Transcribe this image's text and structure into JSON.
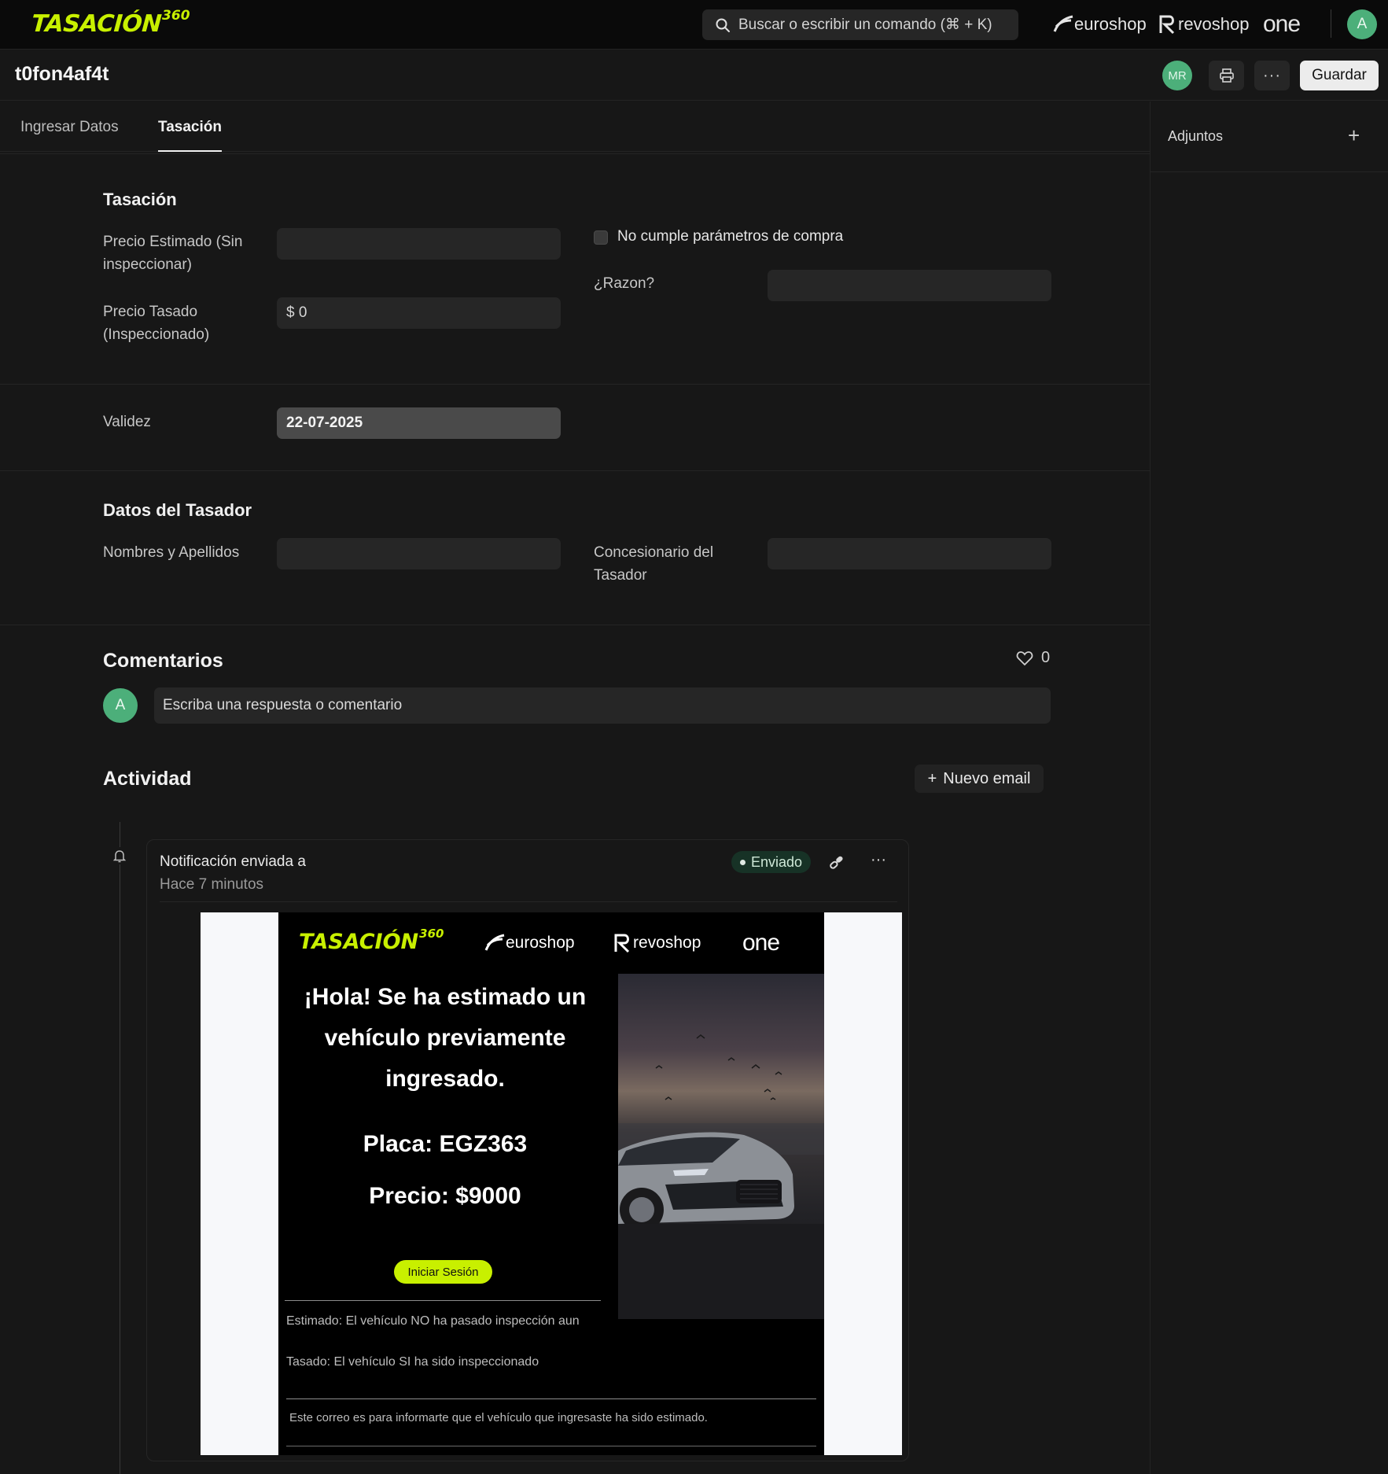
{
  "navbar": {
    "brand": "TASACIÓN",
    "brand_sup": "360",
    "search_placeholder": "Buscar o escribir un comando (⌘ + K)",
    "partners": [
      "euroshop",
      "revoshop",
      "one"
    ],
    "user_initial": "A"
  },
  "header": {
    "doc_title": "t0fon4af4t",
    "assignee_initials": "MR",
    "save_label": "Guardar"
  },
  "tabs": [
    {
      "label": "Ingresar Datos",
      "active": false
    },
    {
      "label": "Tasación",
      "active": true
    }
  ],
  "sidebar": {
    "title": "Adjuntos"
  },
  "tasacion": {
    "title": "Tasación",
    "precio_estimado_label": "Precio Estimado (Sin inspeccionar)",
    "precio_estimado_value": "",
    "precio_tasado_label": "Precio Tasado (Inspeccionado)",
    "precio_tasado_value": "$ 0",
    "no_cumple_label": "No cumple parámetros de compra",
    "no_cumple_checked": false,
    "razon_label": "¿Razon?",
    "razon_value": "",
    "validez_label": "Validez",
    "validez_value": "22-07-2025"
  },
  "tasador": {
    "title": "Datos del Tasador",
    "nombres_label": "Nombres y Apellidos",
    "nombres_value": "",
    "concesionario_label": "Concesionario del Tasador",
    "concesionario_value": ""
  },
  "comentarios": {
    "title": "Comentarios",
    "likes": "0",
    "user_initial": "A",
    "placeholder": "Escriba una respuesta o comentario"
  },
  "actividad": {
    "title": "Actividad",
    "new_email_label": "Nuevo email",
    "notification": {
      "title": "Notificación enviada a",
      "time": "Hace 7 minutos",
      "status": "Enviado"
    }
  },
  "email": {
    "brand": "TASACIÓN",
    "brand_sup": "360",
    "partners": [
      "euroshop",
      "revoshop",
      "one"
    ],
    "headline": "¡Hola! Se ha estimado un vehículo previamente ingresado.",
    "plate": "Placa: EGZ363",
    "price": "Precio: $9000",
    "button_label": "Iniciar Sesión",
    "note_estimado": "Estimado: El vehículo NO ha pasado inspección aun",
    "note_tasado": "Tasado: El vehículo SI ha sido inspeccionado",
    "footer": "Este correo es para informarte que el vehículo que ingresaste ha sido estimado."
  },
  "colors": {
    "brand_accent": "#c8f000",
    "avatar_green": "#4caf7a",
    "background": "#171717"
  }
}
